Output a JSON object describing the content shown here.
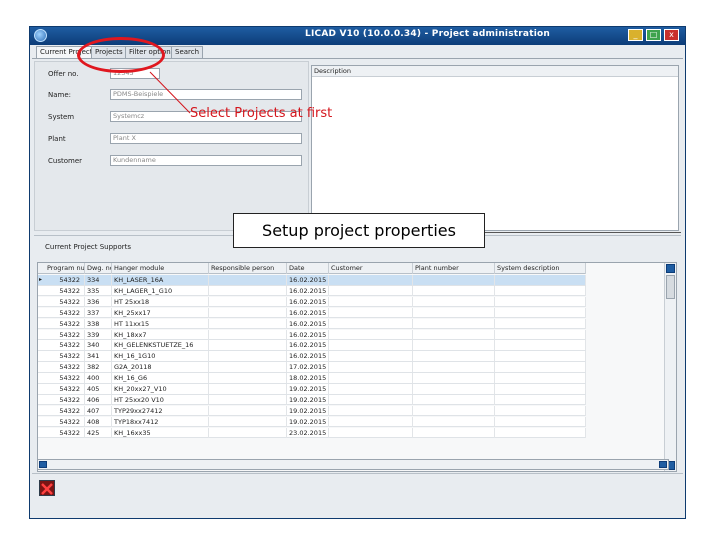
{
  "window": {
    "title": "LICAD V10 (10.0.0.34) - Project administration",
    "minimize": "_",
    "maximize": "□",
    "close": "x"
  },
  "tabs": [
    {
      "label": "Current Project"
    },
    {
      "label": "Projects"
    },
    {
      "label": "Filter options"
    },
    {
      "label": "Search"
    }
  ],
  "project_form": {
    "offer_no": {
      "label": "Offer no.",
      "value": "12345"
    },
    "name": {
      "label": "Name:",
      "value": "PDMS-Beispiele"
    },
    "system": {
      "label": "System",
      "value": "Systemcz"
    },
    "plant": {
      "label": "Plant",
      "value": "Plant X"
    },
    "customer": {
      "label": "Customer",
      "value": "Kundenname"
    }
  },
  "description": {
    "label": "Description",
    "value": ""
  },
  "supports": {
    "title": "Current Project Supports",
    "columns": [
      "Program number",
      "Dwg. no.",
      "Hanger module",
      "Responsible person",
      "Date",
      "Customer",
      "Plant number",
      "System description"
    ],
    "rows": [
      [
        "54322",
        "334",
        "KH_LASER_16A",
        "",
        "16.02.2015",
        "",
        "",
        ""
      ],
      [
        "54322",
        "335",
        "KH_LAGER_1_G10",
        "",
        "16.02.2015",
        "",
        "",
        ""
      ],
      [
        "54322",
        "336",
        "HT 25xx18",
        "",
        "16.02.2015",
        "",
        "",
        ""
      ],
      [
        "54322",
        "337",
        "KH_25xx17",
        "",
        "16.02.2015",
        "",
        "",
        ""
      ],
      [
        "54322",
        "338",
        "HT 11xx15",
        "",
        "16.02.2015",
        "",
        "",
        ""
      ],
      [
        "54322",
        "339",
        "KH_18xx7",
        "",
        "16.02.2015",
        "",
        "",
        ""
      ],
      [
        "54322",
        "340",
        "KH_GELENKSTUETZE_16",
        "",
        "16.02.2015",
        "",
        "",
        ""
      ],
      [
        "54322",
        "341",
        "KH_16_1G10",
        "",
        "16.02.2015",
        "",
        "",
        ""
      ],
      [
        "54322",
        "382",
        "G2A_20118",
        "",
        "17.02.2015",
        "",
        "",
        ""
      ],
      [
        "54322",
        "400",
        "KH_16_G6",
        "",
        "18.02.2015",
        "",
        "",
        ""
      ],
      [
        "54322",
        "405",
        "KH_20xx27_V10",
        "",
        "19.02.2015",
        "",
        "",
        ""
      ],
      [
        "54322",
        "406",
        "HT 25xx20 V10",
        "",
        "19.02.2015",
        "",
        "",
        ""
      ],
      [
        "54322",
        "407",
        "TYP29xx27412",
        "",
        "19.02.2015",
        "",
        "",
        ""
      ],
      [
        "54322",
        "408",
        "TYP18xx7412",
        "",
        "19.02.2015",
        "",
        "",
        ""
      ],
      [
        "54322",
        "425",
        "KH_16xx35",
        "",
        "23.02.2015",
        "",
        "",
        ""
      ]
    ]
  },
  "annotations": {
    "select_projects": "Select Projects at first",
    "setup_properties": "Setup project properties"
  },
  "colors": {
    "title_bar": "#1f5da2",
    "annotation_red": "#d4151c",
    "selected_row": "#c9dff3"
  }
}
